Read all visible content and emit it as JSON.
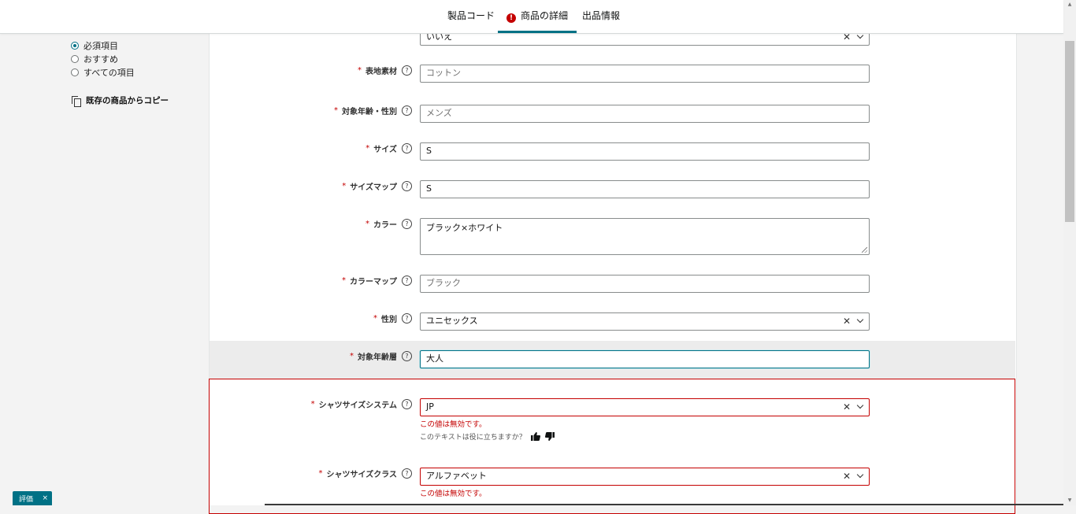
{
  "tabs": [
    {
      "label": "製品コード",
      "active": false,
      "alert": false
    },
    {
      "label": "商品の詳細",
      "active": true,
      "alert": true
    },
    {
      "label": "出品情報",
      "active": false,
      "alert": false
    }
  ],
  "sidebar": {
    "filters": [
      {
        "label": "必須項目",
        "checked": true
      },
      {
        "label": "おすすめ",
        "checked": false
      },
      {
        "label": "すべての項目",
        "checked": false
      }
    ],
    "copy_label": "既存の商品からコピー"
  },
  "fields": {
    "top_value": "いいえ",
    "surface_material": {
      "label": "表地素材",
      "placeholder": "コットン"
    },
    "target_age_gender": {
      "label": "対象年齢・性別",
      "placeholder": "メンズ"
    },
    "size": {
      "label": "サイズ",
      "value": "S"
    },
    "size_map": {
      "label": "サイズマップ",
      "value": "S"
    },
    "color": {
      "label": "カラー",
      "value": "ブラック×ホワイト"
    },
    "color_map": {
      "label": "カラーマップ",
      "placeholder": "ブラック"
    },
    "gender": {
      "label": "性別",
      "value": "ユニセックス"
    },
    "age_range": {
      "label": "対象年齢層",
      "value": "大人"
    },
    "shirt_size_system": {
      "label": "シャツサイズシステム",
      "value": "JP",
      "error": "この値は無効です。"
    },
    "shirt_size_class": {
      "label": "シャツサイズクラス",
      "value": "アルファベット",
      "error": "この値は無効です。"
    }
  },
  "helpful_prompt": "このテキストは役に立ちますか？",
  "feedback_tab": {
    "label": "評価",
    "close": "×"
  },
  "colors": {
    "accent": "#007185",
    "error": "#c40000"
  }
}
